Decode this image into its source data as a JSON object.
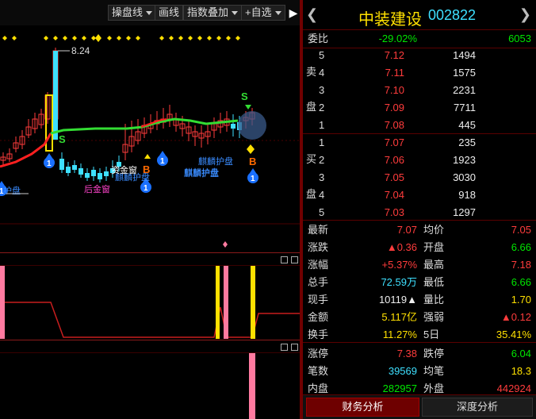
{
  "toolbar": {
    "pan_line": "操盘线",
    "draw_line": "画线",
    "index_overlay": "指数叠加",
    "watchlist": "+自选",
    "collapse": "▶"
  },
  "chart": {
    "high_label": "8.24",
    "signal_s": "S",
    "signal_b": "B",
    "signal_1": "1",
    "label_qilin_1": "麒麟护盘",
    "label_qilin_2": "麒麟护盘",
    "label_qilin_3": "麒麟护盘",
    "label_hou_jin_lu": "后金窗",
    "label_ji_jin_lu": "资金窗",
    "label_hu_pan": "护盘",
    "colors": {
      "up": "#ff3c3c",
      "down": "#3ee0ff",
      "ma_red": "#ff2020",
      "ma_green": "#33dd33",
      "signal_yellow": "#ffe000",
      "signal_blue": "#1a70ff",
      "pink": "#ff7aa0"
    }
  },
  "quote": {
    "prev_icon": "chevron-left",
    "next_icon": "chevron-right",
    "name": "中装建设",
    "code": "002822",
    "weibi_label": "委比",
    "weibi_value": "-29.02%",
    "weibi_diff": "6053",
    "sell_label_1": "卖",
    "sell_label_2": "盘",
    "buy_label_1": "买",
    "buy_label_2": "盘",
    "asks": [
      {
        "level": "5",
        "price": "7.12",
        "volume": "1494"
      },
      {
        "level": "4",
        "price": "7.11",
        "volume": "1575"
      },
      {
        "level": "3",
        "price": "7.10",
        "volume": "2231"
      },
      {
        "level": "2",
        "price": "7.09",
        "volume": "7711"
      },
      {
        "level": "1",
        "price": "7.08",
        "volume": "445"
      }
    ],
    "bids": [
      {
        "level": "1",
        "price": "7.07",
        "volume": "235"
      },
      {
        "level": "2",
        "price": "7.06",
        "volume": "1923"
      },
      {
        "level": "3",
        "price": "7.05",
        "volume": "3030"
      },
      {
        "level": "4",
        "price": "7.04",
        "volume": "918"
      },
      {
        "level": "5",
        "price": "7.03",
        "volume": "1297"
      }
    ],
    "stats": [
      {
        "l1": "最新",
        "v1": "7.07",
        "c1": "red",
        "l2": "均价",
        "v2": "7.05",
        "c2": "red"
      },
      {
        "l1": "涨跌",
        "v1": "▲0.36",
        "c1": "red",
        "l2": "开盘",
        "v2": "6.66",
        "c2": "green"
      },
      {
        "l1": "涨幅",
        "v1": "+5.37%",
        "c1": "red",
        "l2": "最高",
        "v2": "7.18",
        "c2": "red"
      },
      {
        "l1": "总手",
        "v1": "72.59万",
        "c1": "cyan",
        "l2": "最低",
        "v2": "6.66",
        "c2": "green"
      },
      {
        "l1": "现手",
        "v1": "10119▲",
        "c1": "white",
        "l2": "量比",
        "v2": "1.70",
        "c2": "yellow"
      },
      {
        "l1": "金额",
        "v1": "5.117亿",
        "c1": "yellow",
        "l2": "强弱",
        "v2": "▲0.12",
        "c2": "red"
      },
      {
        "l1": "换手",
        "v1": "11.27%",
        "c1": "yellow",
        "l2": "5日",
        "v2": "35.41%",
        "c2": "yellow"
      },
      {
        "l1": "涨停",
        "v1": "7.38",
        "c1": "red",
        "l2": "跌停",
        "v2": "6.04",
        "c2": "green"
      },
      {
        "l1": "笔数",
        "v1": "39569",
        "c1": "cyan",
        "l2": "均笔",
        "v2": "18.3",
        "c2": "yellow"
      },
      {
        "l1": "内盘",
        "v1": "282957",
        "c1": "green",
        "l2": "外盘",
        "v2": "442924",
        "c2": "red"
      }
    ],
    "tab_finance": "财务分析",
    "tab_depth": "深度分析"
  }
}
